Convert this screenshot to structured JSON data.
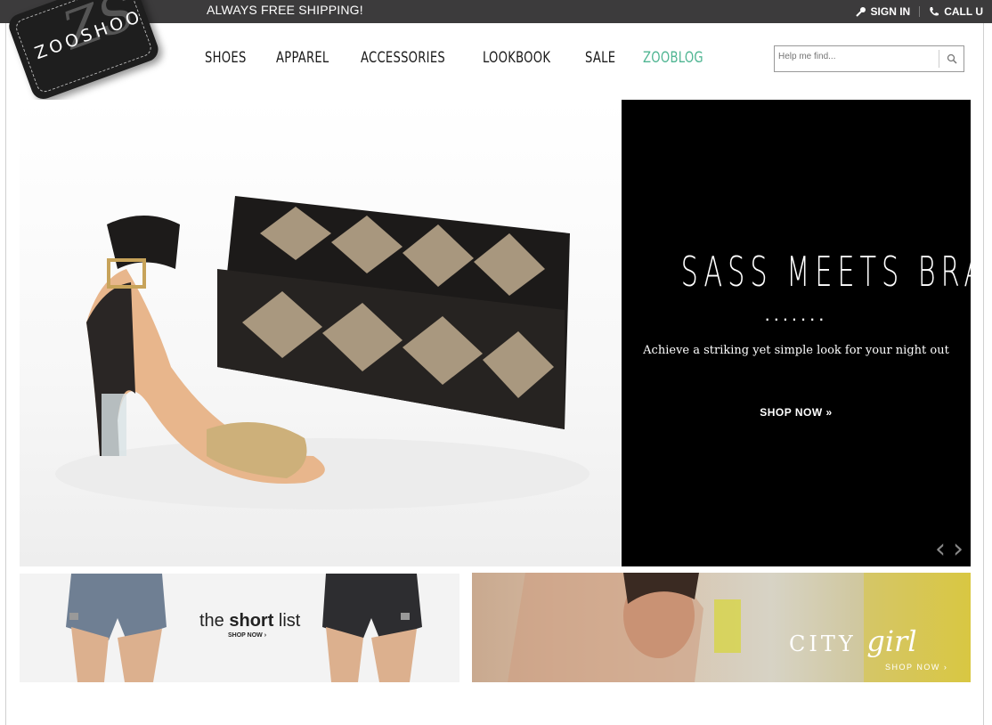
{
  "topbar": {
    "shipping": "ALWAYS FREE SHIPPING!",
    "sign_in": "SIGN IN",
    "call": "CALL U",
    "background": "#3c3b3c"
  },
  "logo": {
    "wordmark": "ZOOSHOO",
    "monogram": "ZS"
  },
  "nav": {
    "items": [
      {
        "label": "SHOES"
      },
      {
        "label": "APPAREL"
      },
      {
        "label": "ACCESSORIES"
      },
      {
        "label": "LOOKBOOK"
      },
      {
        "label": "SALE"
      },
      {
        "label": "ZOOBLOG"
      }
    ],
    "blog_color": "#4fb592"
  },
  "search": {
    "placeholder": "Help me find..."
  },
  "hero": {
    "title": "SASS MEETS BRASS",
    "dots": ".......",
    "subtitle": "Achieve a striking yet simple look for your night out",
    "cta": "SHOP NOW »",
    "prev": "‹",
    "next": "›"
  },
  "promos": {
    "left": {
      "headline_pre": "the ",
      "headline_bold": "short",
      "headline_post": " list",
      "cta": "SHOP NOW ›"
    },
    "right": {
      "title_caps": "CITY ",
      "title_script": "girl",
      "cta": "SHOP NOW ›"
    }
  },
  "icons": [
    "key-icon",
    "phone-icon",
    "search-icon",
    "chevron-left-icon",
    "chevron-right-icon"
  ]
}
